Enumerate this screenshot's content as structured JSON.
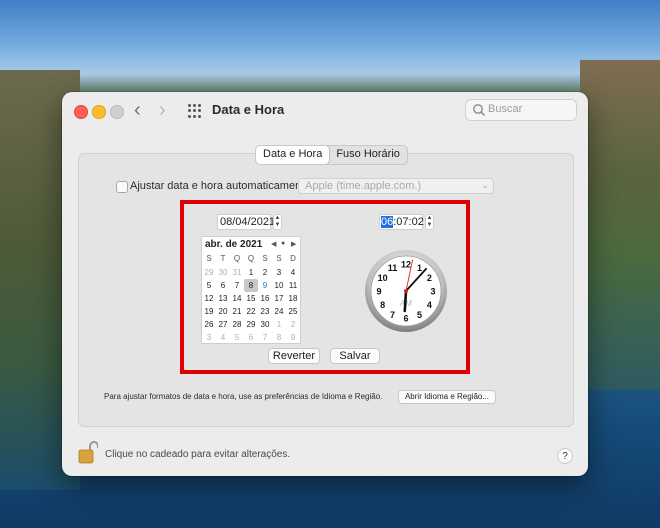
{
  "window": {
    "title": "Data e Hora",
    "search_placeholder": "Buscar"
  },
  "tabs": [
    {
      "label": "Data e Hora",
      "active": true
    },
    {
      "label": "Fuso Horário",
      "active": false
    }
  ],
  "auto_time": {
    "label": "Ajustar data e hora automaticamente:",
    "checked": false,
    "server": "Apple (time.apple.com.)"
  },
  "date": {
    "value": "08/04/2021",
    "month_label": "abr. de 2021",
    "weekdays": [
      "S",
      "T",
      "Q",
      "Q",
      "S",
      "S",
      "D"
    ],
    "days": [
      {
        "d": "29",
        "muted": true
      },
      {
        "d": "30",
        "muted": true
      },
      {
        "d": "31",
        "muted": true
      },
      {
        "d": "1"
      },
      {
        "d": "2"
      },
      {
        "d": "3"
      },
      {
        "d": "4"
      },
      {
        "d": "5"
      },
      {
        "d": "6"
      },
      {
        "d": "7"
      },
      {
        "d": "8",
        "selected": true
      },
      {
        "d": "9",
        "today": true
      },
      {
        "d": "10"
      },
      {
        "d": "11"
      },
      {
        "d": "12"
      },
      {
        "d": "13"
      },
      {
        "d": "14"
      },
      {
        "d": "15"
      },
      {
        "d": "16"
      },
      {
        "d": "17"
      },
      {
        "d": "18"
      },
      {
        "d": "19"
      },
      {
        "d": "20"
      },
      {
        "d": "21"
      },
      {
        "d": "22"
      },
      {
        "d": "23"
      },
      {
        "d": "24"
      },
      {
        "d": "25"
      },
      {
        "d": "26"
      },
      {
        "d": "27"
      },
      {
        "d": "28"
      },
      {
        "d": "29"
      },
      {
        "d": "30"
      },
      {
        "d": "1",
        "muted": true
      },
      {
        "d": "2",
        "muted": true
      },
      {
        "d": "3",
        "muted": true
      },
      {
        "d": "4",
        "muted": true
      },
      {
        "d": "5",
        "muted": true
      },
      {
        "d": "6",
        "muted": true
      },
      {
        "d": "7",
        "muted": true
      },
      {
        "d": "8",
        "muted": true
      },
      {
        "d": "9",
        "muted": true
      }
    ]
  },
  "time": {
    "hour": "06",
    "rest": ":07:02",
    "clock_hour": 6,
    "clock_minute": 7,
    "clock_second": 2,
    "clock_period": "AM",
    "clock_numbers": [
      "12",
      "1",
      "2",
      "3",
      "4",
      "5",
      "6",
      "7",
      "8",
      "9",
      "10",
      "11"
    ]
  },
  "buttons": {
    "revert": "Reverter",
    "save": "Salvar",
    "open_region": "Abrir Idioma e Região..."
  },
  "formats_text": "Para ajustar formatos de data e hora, use as preferências de Idioma e Região.",
  "lock_text": "Clique no cadeado para evitar alterações.",
  "help_label": "?",
  "colors": {
    "highlight": "#e00000",
    "selection": "#1f6fe0",
    "second_hand": "#e02020"
  }
}
